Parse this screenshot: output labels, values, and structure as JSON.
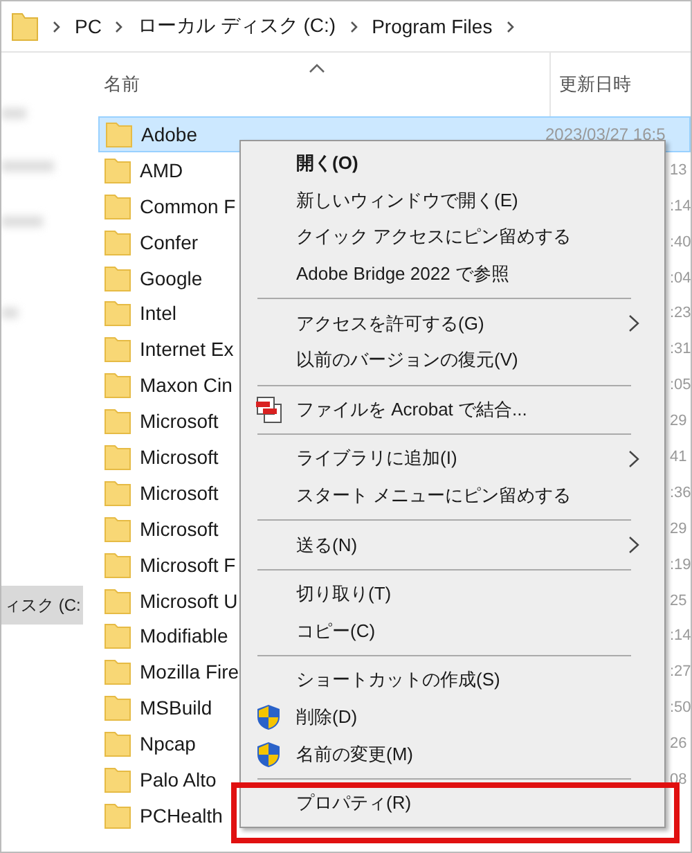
{
  "breadcrumb": [
    {
      "label": "PC"
    },
    {
      "label": "ローカル ディスク (C:)"
    },
    {
      "label": "Program Files"
    }
  ],
  "nav_pane": {
    "items": [
      {
        "label": "ィスク (C:",
        "selected": true
      }
    ]
  },
  "table": {
    "columns": [
      {
        "label": "名前",
        "sorted": true
      },
      {
        "label": "更新日時",
        "sorted": false
      }
    ],
    "rows": [
      {
        "name": "Adobe",
        "selected": true,
        "date": "2023/03/27 16:5"
      },
      {
        "name": "AMD",
        "selected": false,
        "date_fragment": "13"
      },
      {
        "name": "Common F",
        "selected": false,
        "date_fragment": ":14"
      },
      {
        "name": "Confer",
        "selected": false,
        "date_fragment": ":40"
      },
      {
        "name": "Google",
        "selected": false,
        "date_fragment": ":04"
      },
      {
        "name": "Intel",
        "selected": false,
        "date_fragment": ":23"
      },
      {
        "name": "Internet Ex",
        "selected": false,
        "date_fragment": ":31"
      },
      {
        "name": "Maxon Cin",
        "selected": false,
        "date_fragment": ":05"
      },
      {
        "name": "Microsoft",
        "selected": false,
        "date_fragment": "29"
      },
      {
        "name": "Microsoft",
        "selected": false,
        "date_fragment": "41"
      },
      {
        "name": "Microsoft",
        "selected": false,
        "date_fragment": ":36"
      },
      {
        "name": "Microsoft",
        "selected": false,
        "date_fragment": "29"
      },
      {
        "name": "Microsoft F",
        "selected": false,
        "date_fragment": ":19"
      },
      {
        "name": "Microsoft U",
        "selected": false,
        "date_fragment": "25"
      },
      {
        "name": "Modifiable",
        "selected": false,
        "date_fragment": ":14"
      },
      {
        "name": "Mozilla Fire",
        "selected": false,
        "date_fragment": ":27"
      },
      {
        "name": "MSBuild",
        "selected": false,
        "date_fragment": ":50"
      },
      {
        "name": "Npcap",
        "selected": false,
        "date_fragment": "26"
      },
      {
        "name": "Palo Alto",
        "selected": false,
        "date_fragment": "08"
      },
      {
        "name": "PCHealth",
        "selected": false
      }
    ]
  },
  "context_menu": {
    "items": [
      {
        "kind": "item",
        "label": "開く(O)",
        "bold": true
      },
      {
        "kind": "item",
        "label": "新しいウィンドウで開く(E)"
      },
      {
        "kind": "item",
        "label": "クイック アクセスにピン留めする"
      },
      {
        "kind": "item",
        "label": "Adobe Bridge 2022 で参照"
      },
      {
        "kind": "separator"
      },
      {
        "kind": "item",
        "label": "アクセスを許可する(G)",
        "submenu": true
      },
      {
        "kind": "item",
        "label": "以前のバージョンの復元(V)"
      },
      {
        "kind": "separator"
      },
      {
        "kind": "acrobat_item",
        "label": "ファイルを Acrobat で結合..."
      },
      {
        "kind": "separator"
      },
      {
        "kind": "item",
        "label": "ライブラリに追加(I)",
        "submenu": true
      },
      {
        "kind": "item",
        "label": "スタート メニューにピン留めする"
      },
      {
        "kind": "separator"
      },
      {
        "kind": "item",
        "label": "送る(N)",
        "submenu": true
      },
      {
        "kind": "separator"
      },
      {
        "kind": "item",
        "label": "切り取り(T)"
      },
      {
        "kind": "item",
        "label": "コピー(C)"
      },
      {
        "kind": "separator"
      },
      {
        "kind": "item",
        "label": "ショートカットの作成(S)"
      },
      {
        "kind": "shield_item",
        "label": "削除(D)"
      },
      {
        "kind": "shield_item",
        "label": "名前の変更(M)"
      },
      {
        "kind": "separator"
      },
      {
        "kind": "item",
        "label": "プロパティ(R)",
        "highlighted": true
      }
    ]
  }
}
